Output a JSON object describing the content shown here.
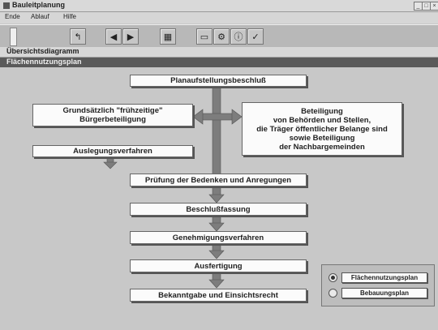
{
  "window": {
    "title": "Bauleitplanung",
    "controls": [
      "_",
      "□",
      "×"
    ]
  },
  "menu": {
    "items": [
      "Ende",
      "Ablauf",
      "Hilfe"
    ]
  },
  "toolbar": {
    "buttons": [
      {
        "icon": "return-arrow-icon",
        "glyph": "↰"
      },
      {
        "icon": "previous-icon",
        "glyph": "◀"
      },
      {
        "icon": "next-icon",
        "glyph": "▶"
      },
      {
        "icon": "overview-icon",
        "glyph": "▦"
      },
      {
        "icon": "document-icon",
        "glyph": "▭"
      },
      {
        "icon": "settings-icon",
        "glyph": "⚙"
      },
      {
        "icon": "info-icon",
        "glyph": "ⓘ"
      },
      {
        "icon": "check-icon",
        "glyph": "✓"
      }
    ]
  },
  "section": {
    "title": "Übersichtsdiagramm",
    "subtitle": "Flächennutzungsplan"
  },
  "diagram": {
    "steps": {
      "planaufstellung": "Planaufstellungsbeschluß",
      "buergerbeteiligung": [
        "Grundsätzlich \"frühzeitige\"",
        "Bürgerbeteiligung"
      ],
      "behoerdenbeteiligung": [
        "Beteiligung",
        "von Behörden und Stellen,",
        "die Träger öffentlicher Belange sind",
        "sowie Beteiligung",
        "der Nachbargemeinden"
      ],
      "auslegung": "Auslegungsverfahren",
      "pruefung": "Prüfung der Bedenken und Anregungen",
      "beschluss": "Beschlußfassung",
      "genehmigung": "Genehmigungsverfahren",
      "ausfertigung": "Ausfertigung",
      "bekanntgabe": "Bekanntgabe und Einsichtsrecht"
    },
    "arrow_color": "#7d7d7d"
  },
  "legend": {
    "options": [
      {
        "label": "Flächennutzungsplan",
        "selected": true
      },
      {
        "label": "Bebauungsplan",
        "selected": false
      }
    ]
  }
}
